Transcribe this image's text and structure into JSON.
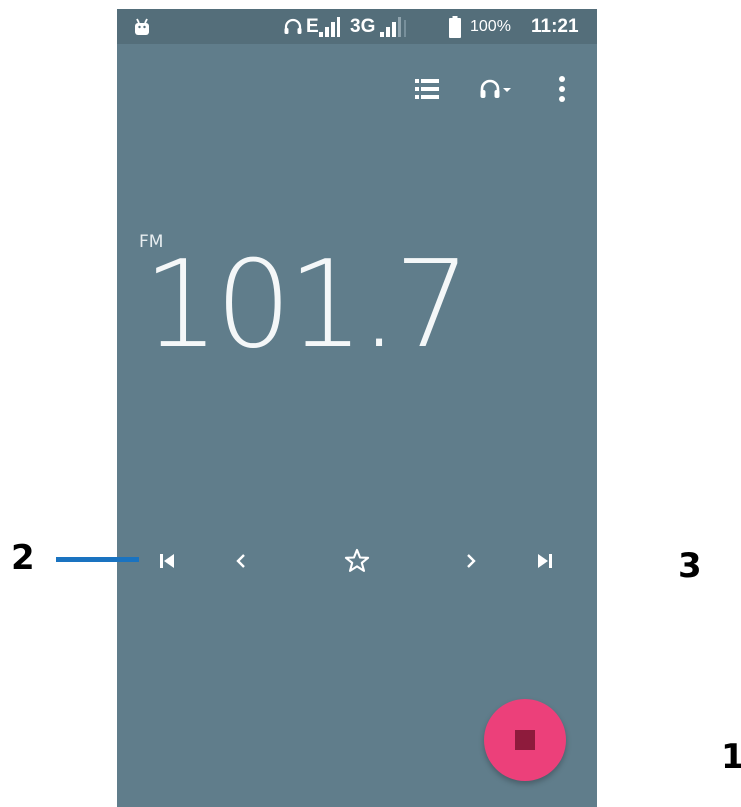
{
  "status_bar": {
    "network_e": "E",
    "network_3g": "3G",
    "battery_percent": "100%",
    "time": "11:21",
    "icons": [
      "android-debug-icon",
      "headset-icon",
      "signal-icon",
      "signal-icon",
      "battery-icon"
    ]
  },
  "toolbar": {
    "icons": [
      "station-list-icon",
      "headset-dropdown-icon",
      "more-vertical-icon"
    ]
  },
  "radio": {
    "band": "FM",
    "frequency": "101.7"
  },
  "controls": {
    "icons": [
      "skip-previous-icon",
      "chevron-left-icon",
      "star-outline-icon",
      "chevron-right-icon",
      "skip-next-icon"
    ]
  },
  "fab": {
    "icon": "stop-icon",
    "color": "#ec407a"
  },
  "callouts": {
    "left": "2",
    "right": "3",
    "bottom_right": "1"
  },
  "colors": {
    "background": "#607d8b",
    "status_bar": "#546e7a",
    "callout_line": "#1a73c0"
  }
}
